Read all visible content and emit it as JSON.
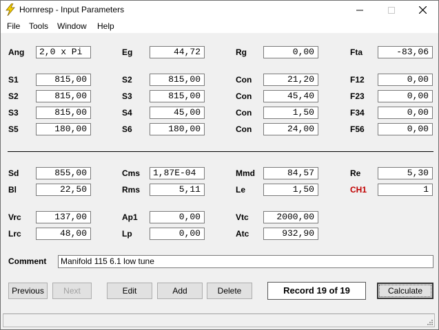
{
  "window": {
    "title": "Hornresp - Input Parameters",
    "controls": {
      "minimize_icon": "minimize-icon",
      "maximize_icon": "maximize-icon",
      "close_icon": "close-icon"
    }
  },
  "menu": [
    "File",
    "Tools",
    "Window",
    "Help"
  ],
  "params": {
    "ang": {
      "label": "Ang",
      "value": "2,0 x Pi"
    },
    "eg": {
      "label": "Eg",
      "value": "44,72"
    },
    "rg": {
      "label": "Rg",
      "value": "0,00"
    },
    "fta": {
      "label": "Fta",
      "value": "-83,06"
    },
    "s1": {
      "label": "S1",
      "value": "815,00"
    },
    "s2b": {
      "label": "S2",
      "value": "815,00"
    },
    "con1": {
      "label": "Con",
      "value": "21,20"
    },
    "f12": {
      "label": "F12",
      "value": "0,00"
    },
    "s2": {
      "label": "S2",
      "value": "815,00"
    },
    "s3b": {
      "label": "S3",
      "value": "815,00"
    },
    "con2": {
      "label": "Con",
      "value": "45,40"
    },
    "f23": {
      "label": "F23",
      "value": "0,00"
    },
    "s3": {
      "label": "S3",
      "value": "815,00"
    },
    "s4": {
      "label": "S4",
      "value": "45,00"
    },
    "con3": {
      "label": "Con",
      "value": "1,50"
    },
    "f34": {
      "label": "F34",
      "value": "0,00"
    },
    "s5": {
      "label": "S5",
      "value": "180,00"
    },
    "s6": {
      "label": "S6",
      "value": "180,00"
    },
    "con4": {
      "label": "Con",
      "value": "24,00"
    },
    "f56": {
      "label": "F56",
      "value": "0,00"
    },
    "sd": {
      "label": "Sd",
      "value": "855,00"
    },
    "cms": {
      "label": "Cms",
      "value": "1,87E-04"
    },
    "mmd": {
      "label": "Mmd",
      "value": "84,57"
    },
    "re": {
      "label": "Re",
      "value": "5,30"
    },
    "bl": {
      "label": "Bl",
      "value": "22,50"
    },
    "rms": {
      "label": "Rms",
      "value": "5,11"
    },
    "le": {
      "label": "Le",
      "value": "1,50"
    },
    "ch1": {
      "label": "CH1",
      "value": "1"
    },
    "vrc": {
      "label": "Vrc",
      "value": "137,00"
    },
    "ap1": {
      "label": "Ap1",
      "value": "0,00"
    },
    "vtc": {
      "label": "Vtc",
      "value": "2000,00"
    },
    "lrc": {
      "label": "Lrc",
      "value": "48,00"
    },
    "lp": {
      "label": "Lp",
      "value": "0,00"
    },
    "atc": {
      "label": "Atc",
      "value": "932,90"
    }
  },
  "comment": {
    "label": "Comment",
    "value": "Manifold 115 6.1 low tune"
  },
  "buttons": {
    "previous": "Previous",
    "next": "Next",
    "edit": "Edit",
    "add": "Add",
    "delete": "Delete",
    "calculate": "Calculate"
  },
  "record": "Record 19 of 19",
  "colors": {
    "ch1_label": "#c00000",
    "titlebar": "#ffffff",
    "background": "#f0f0f0"
  }
}
